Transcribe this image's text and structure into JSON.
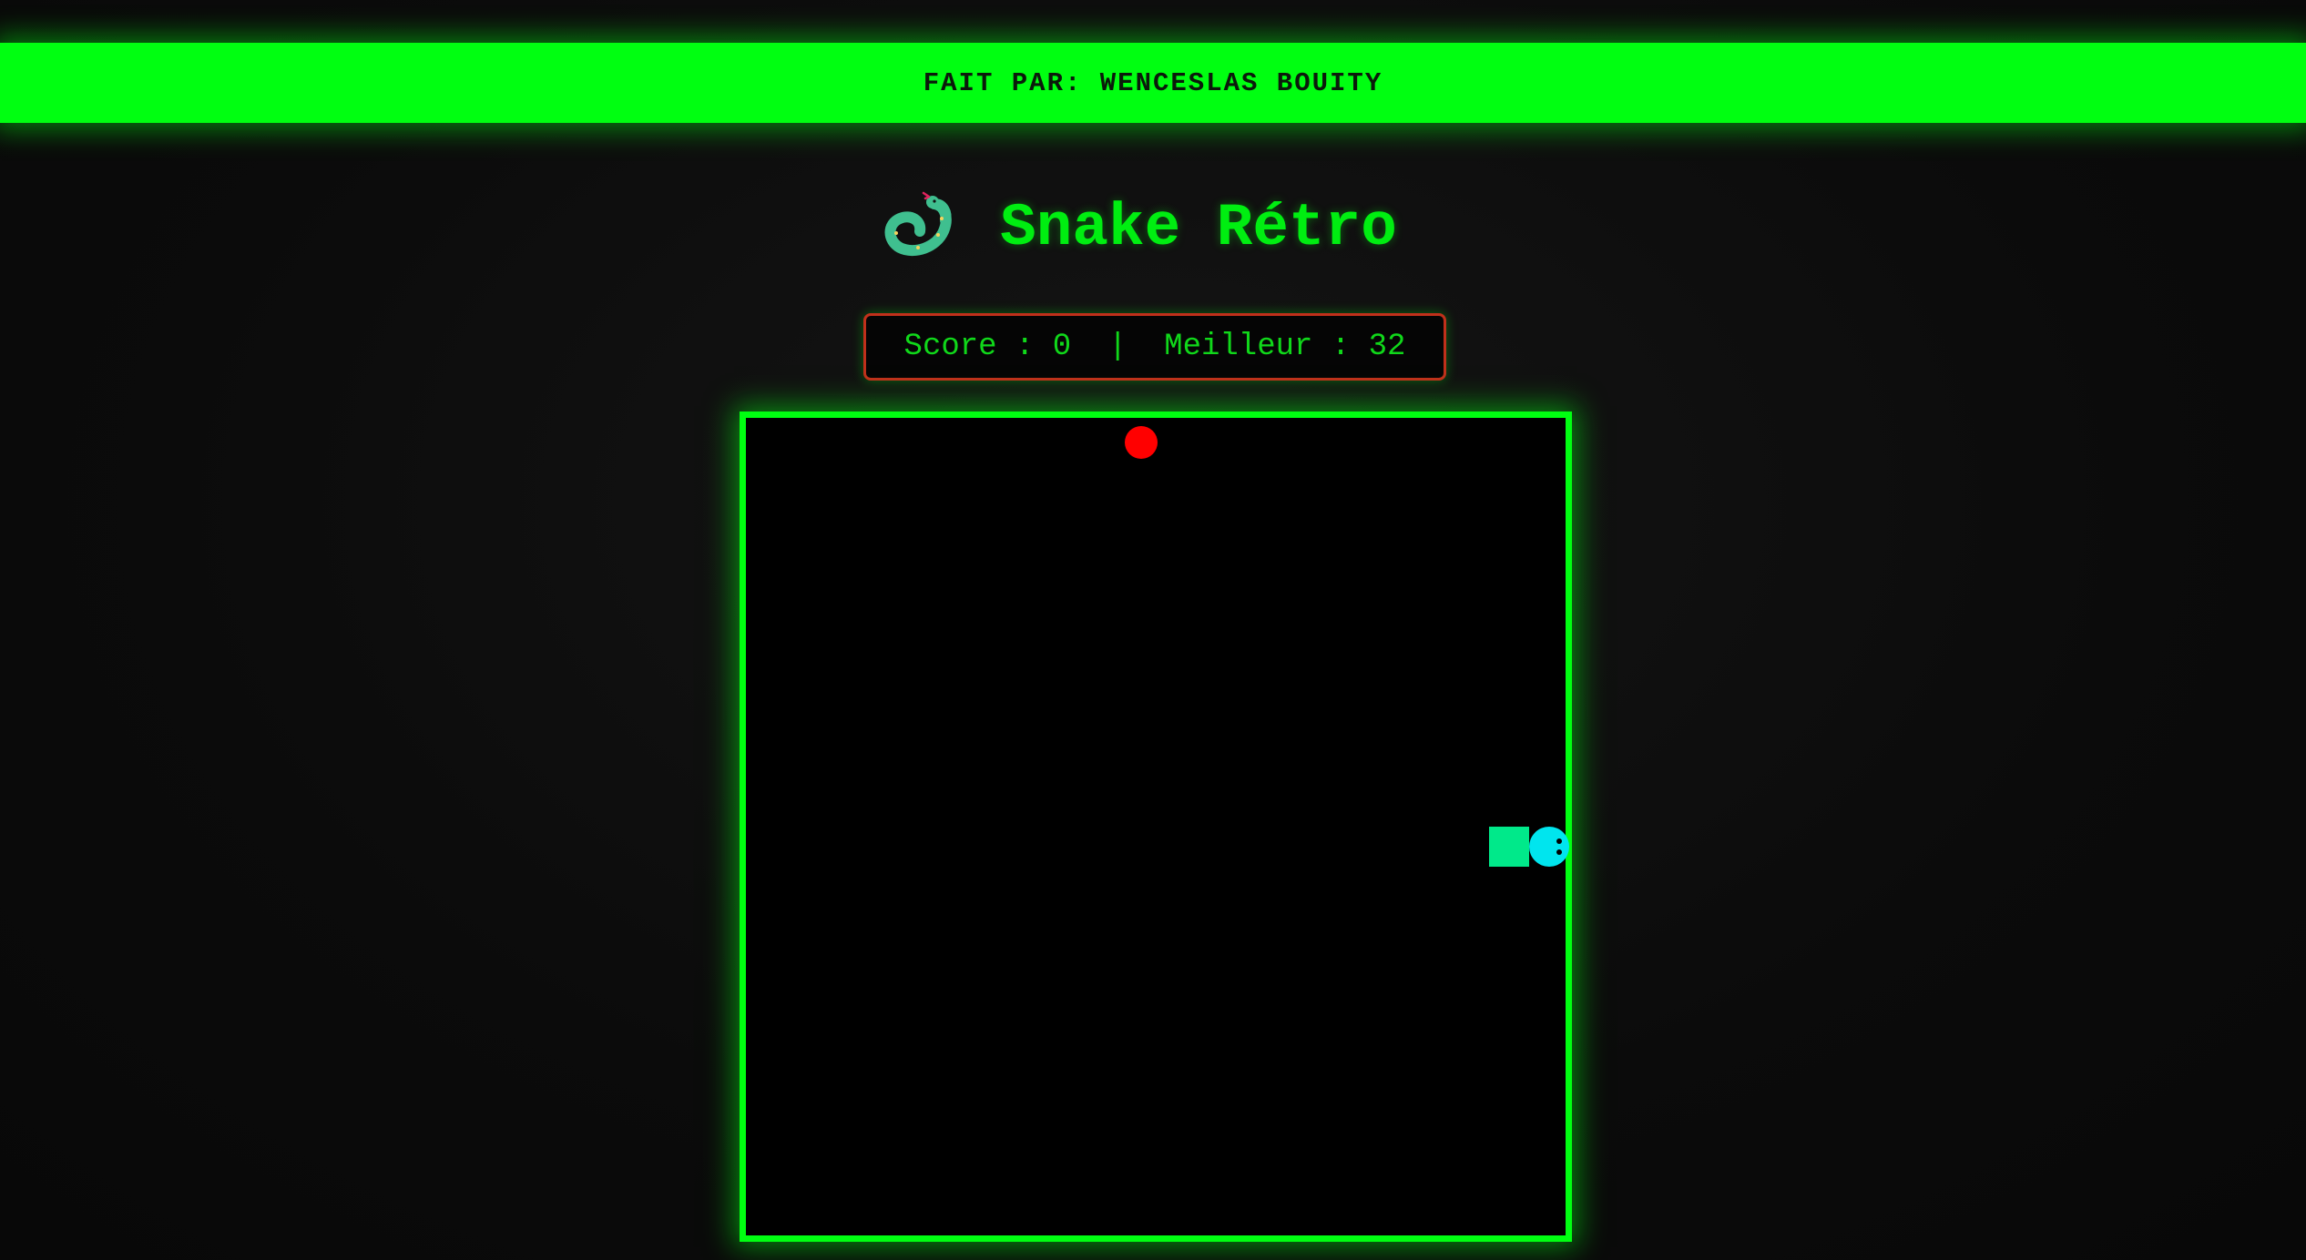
{
  "banner": {
    "text": "FAIT PAR: WENCESLAS BOUITY"
  },
  "header": {
    "icon": "snake-icon",
    "title": "Snake Rétro"
  },
  "score": {
    "text": "Score : 0  |  Meilleur : 32"
  },
  "game": {
    "food": {
      "icon": "apple-dot",
      "color": "#ff0000"
    },
    "snake": {
      "head_color": "#00e5ee",
      "body_color": "#00e98a",
      "length": 2
    }
  },
  "colors": {
    "accent": "#00ff11",
    "score_border": "#c0301b",
    "background": "#0b0b0b"
  }
}
